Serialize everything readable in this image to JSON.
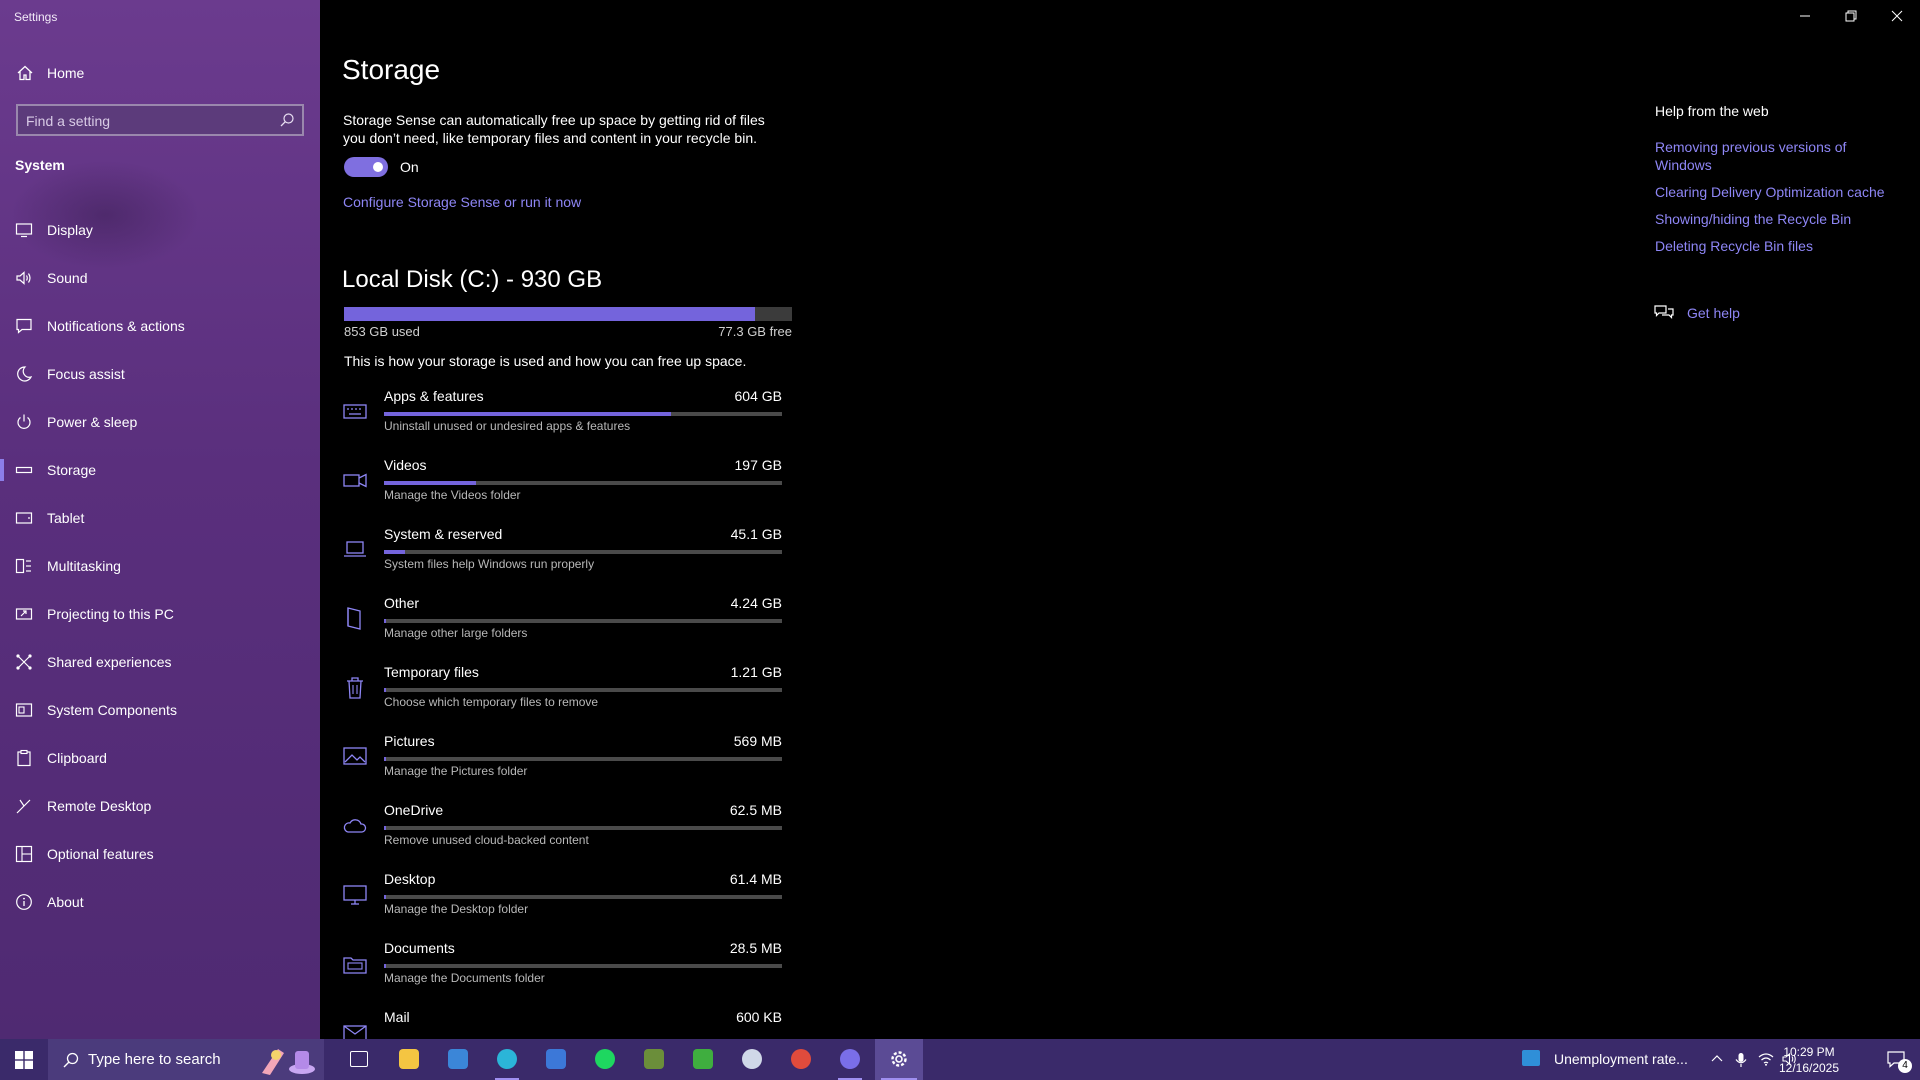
{
  "window": {
    "app_title": "Settings"
  },
  "sidebar": {
    "home_label": "Home",
    "search_placeholder": "Find a setting",
    "section_title": "System",
    "items": [
      {
        "label": "Display",
        "icon": "display-icon"
      },
      {
        "label": "Sound",
        "icon": "sound-icon"
      },
      {
        "label": "Notifications & actions",
        "icon": "notifications-icon"
      },
      {
        "label": "Focus assist",
        "icon": "moon-icon"
      },
      {
        "label": "Power & sleep",
        "icon": "power-icon"
      },
      {
        "label": "Storage",
        "icon": "storage-icon",
        "active": true
      },
      {
        "label": "Tablet",
        "icon": "tablet-icon"
      },
      {
        "label": "Multitasking",
        "icon": "multitasking-icon"
      },
      {
        "label": "Projecting to this PC",
        "icon": "projecting-icon"
      },
      {
        "label": "Shared experiences",
        "icon": "shared-experiences-icon"
      },
      {
        "label": "System Components",
        "icon": "system-components-icon"
      },
      {
        "label": "Clipboard",
        "icon": "clipboard-icon"
      },
      {
        "label": "Remote Desktop",
        "icon": "remote-desktop-icon"
      },
      {
        "label": "Optional features",
        "icon": "optional-features-icon"
      },
      {
        "label": "About",
        "icon": "info-icon"
      }
    ]
  },
  "main": {
    "title": "Storage",
    "description": "Storage Sense can automatically free up space by getting rid of files you don’t need, like temporary files and content in your recycle bin.",
    "toggle_state": "On",
    "toggle_on": true,
    "configure_link": "Configure Storage Sense or run it now",
    "disk": {
      "title": "Local Disk (C:) - 930 GB",
      "used": "853 GB used",
      "free": "77.3 GB free",
      "used_fraction": 0.917
    },
    "storage_note": "This is how your storage is used and how you can free up space.",
    "categories": [
      {
        "name": "Apps & features",
        "size": "604 GB",
        "desc": "Uninstall unused or undesired apps & features",
        "fraction": 0.72,
        "icon": "keyboard-icon"
      },
      {
        "name": "Videos",
        "size": "197 GB",
        "desc": "Manage the Videos folder",
        "fraction": 0.23,
        "icon": "video-icon"
      },
      {
        "name": "System & reserved",
        "size": "45.1 GB",
        "desc": "System files help Windows run properly",
        "fraction": 0.053,
        "icon": "laptop-icon"
      },
      {
        "name": "Other",
        "size": "4.24 GB",
        "desc": "Manage other large folders",
        "fraction": 0.005,
        "icon": "folder-icon"
      },
      {
        "name": "Temporary files",
        "size": "1.21 GB",
        "desc": "Choose which temporary files to remove",
        "fraction": 0.002,
        "icon": "trash-icon"
      },
      {
        "name": "Pictures",
        "size": "569 MB",
        "desc": "Manage the Pictures folder",
        "fraction": 0.001,
        "icon": "picture-icon"
      },
      {
        "name": "OneDrive",
        "size": "62.5 MB",
        "desc": "Remove unused cloud-backed content",
        "fraction": 0.0005,
        "icon": "cloud-icon"
      },
      {
        "name": "Desktop",
        "size": "61.4 MB",
        "desc": "Manage the Desktop folder",
        "fraction": 0.0005,
        "icon": "monitor-icon"
      },
      {
        "name": "Documents",
        "size": "28.5 MB",
        "desc": "Manage the Documents folder",
        "fraction": 0.0003,
        "icon": "documents-icon"
      },
      {
        "name": "Mail",
        "size": "600 KB",
        "desc": "",
        "fraction": 0.0,
        "icon": "mail-icon"
      }
    ]
  },
  "help": {
    "title": "Help from the web",
    "links": [
      "Removing previous versions of Windows",
      "Clearing Delivery Optimization cache",
      "Showing/hiding the Recycle Bin",
      "Deleting Recycle Bin files"
    ],
    "get_help": "Get help"
  },
  "taskbar": {
    "search_placeholder": "Type here to search",
    "apps": [
      {
        "name": "task-view-icon",
        "color": "#ffffff"
      },
      {
        "name": "file-explorer-icon",
        "color": "#f4c542"
      },
      {
        "name": "microsoft-store-icon",
        "color": "#3b86d8"
      },
      {
        "name": "edge-icon",
        "color": "#2bb5d8",
        "open": true
      },
      {
        "name": "photos-icon",
        "color": "#3c78d8"
      },
      {
        "name": "spotify-icon",
        "color": "#1ed760"
      },
      {
        "name": "minecraft-icon",
        "color": "#6b8e3a"
      },
      {
        "name": "minecraft-launcher-icon",
        "color": "#3fae3f"
      },
      {
        "name": "steam-icon",
        "color": "#d0d8e8"
      },
      {
        "name": "chrome-icon",
        "color": "#e04b3c"
      },
      {
        "name": "discord-icon",
        "color": "#7a6ee8",
        "open": true
      },
      {
        "name": "settings-icon",
        "color": "#ffffff",
        "active": true
      }
    ],
    "news": "Unemployment rate...",
    "time": "10:29 PM",
    "date": "12/16/2025",
    "notification_count": "4"
  }
}
